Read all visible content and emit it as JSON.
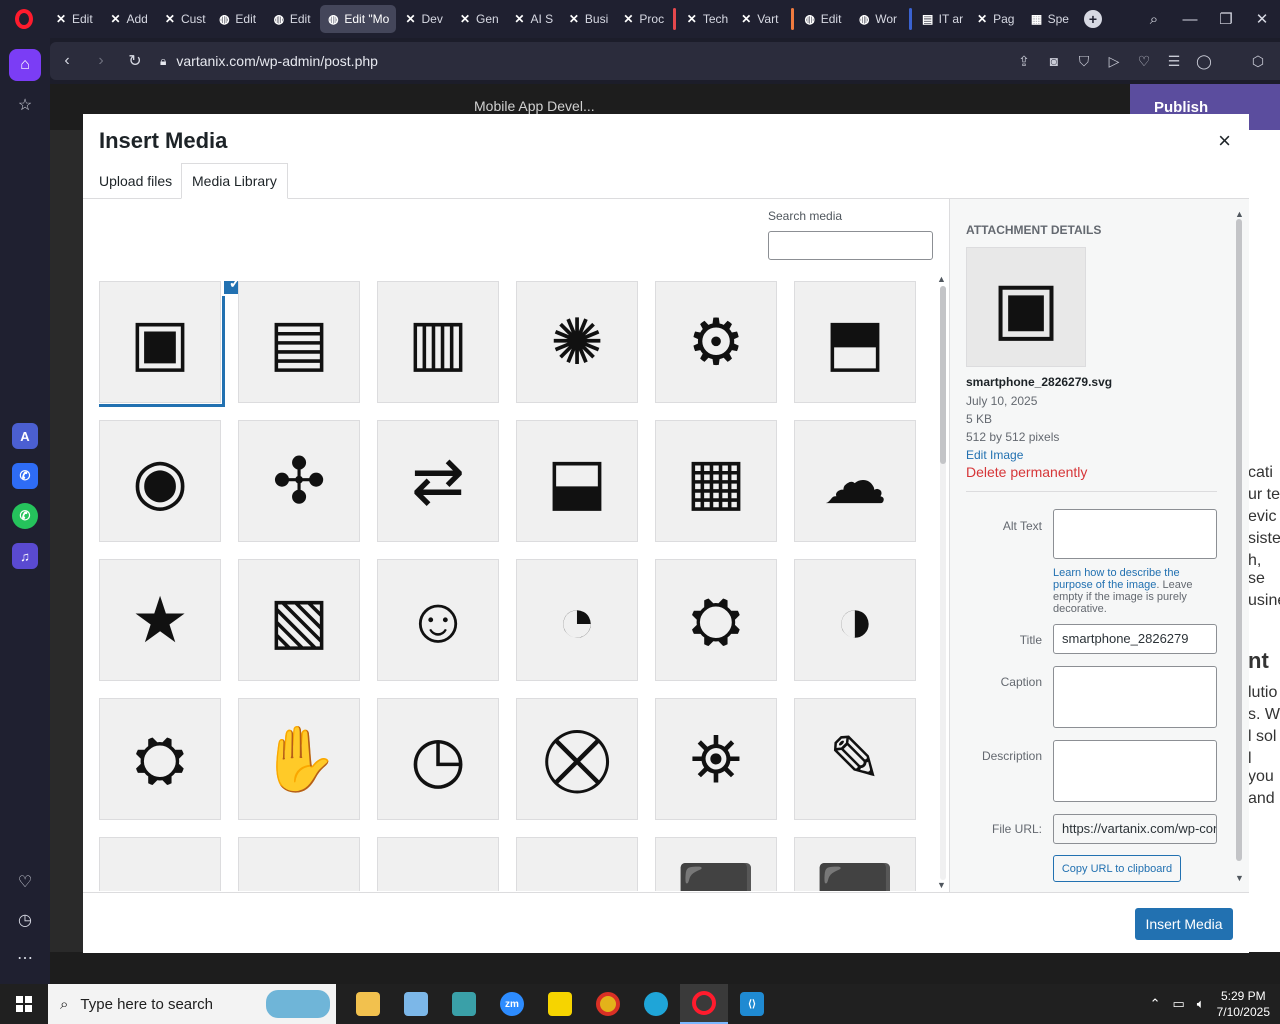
{
  "browser": {
    "tabs": [
      {
        "label": "Edit",
        "icon": "x-icon",
        "active": false
      },
      {
        "label": "Add",
        "icon": "x-icon",
        "active": false
      },
      {
        "label": "Cust",
        "icon": "x-icon",
        "active": false
      },
      {
        "label": "Edit",
        "icon": "globe-icon",
        "active": false
      },
      {
        "label": "Edit",
        "icon": "globe-icon",
        "active": false
      },
      {
        "label": "Edit \"Mo",
        "icon": "globe-icon",
        "active": true
      },
      {
        "label": "Dev",
        "icon": "x-icon",
        "active": false
      },
      {
        "label": "Gen",
        "icon": "x-icon",
        "active": false
      },
      {
        "label": "AI S",
        "icon": "x-icon",
        "active": false
      },
      {
        "label": "Busi",
        "icon": "x-icon",
        "active": false
      },
      {
        "label": "Proc",
        "icon": "x-icon",
        "active": false
      },
      {
        "label": "Tech",
        "icon": "x-icon",
        "active": false
      },
      {
        "label": "Vart",
        "icon": "x-icon",
        "active": false
      },
      {
        "label": "Edit",
        "icon": "globe-icon",
        "active": false
      },
      {
        "label": "Wor",
        "icon": "globe-icon",
        "active": false
      },
      {
        "label": "IT ar",
        "icon": "page-icon",
        "active": false
      },
      {
        "label": "Pag",
        "icon": "x-icon",
        "active": false
      },
      {
        "label": "Spe",
        "icon": "grid-icon",
        "active": false
      }
    ],
    "url": "vartanix.com/wp-admin/post.php"
  },
  "editor": {
    "doc_title": "Mobile App Devel...",
    "publish_label": "Publish",
    "right_peek": [
      "cati",
      "ur te",
      "evic",
      "siste",
      "h, se",
      "usine",
      "nt",
      "lutio",
      "s. W",
      "l sol",
      "l you",
      "and"
    ]
  },
  "modal": {
    "title": "Insert Media",
    "close_symbol": "×",
    "tabs": {
      "upload": "Upload files",
      "library": "Media Library"
    },
    "search_label": "Search media",
    "search_value": "",
    "insert_label": "Insert Media",
    "media_icons": [
      "smartphone-network-icon",
      "smartphone-dial-icon",
      "tablet-star-icon",
      "lightbulb-helpdesk-icon",
      "gear-path-user-icon",
      "browser-gear-arrow-icon",
      "idea-security-flow-icon",
      "target-arrows-icon",
      "process-flow-icon",
      "browser-bug-icon",
      "server-user-network-icon",
      "cloud-server-chart-icon",
      "phone-rating-thumb-icon",
      "phone-cloud-network-icon",
      "team-idea-icon",
      "report-cycle-clock-icon",
      "growth-conveyor-icon",
      "monitor-gauge-icon",
      "growth-conveyor-2-icon",
      "puzzle-hand-icon",
      "browser-clock-icon",
      "cart-gear-icon",
      "gear-dashboard-icon",
      "blueprint-pencil-icon",
      "browser-window-icon",
      "browser-stack-icon",
      "browser-disk-icon",
      "browser-timeline-icon",
      "box-icon",
      "box-2-icon"
    ]
  },
  "details": {
    "heading": "Attachment Details",
    "filename": "smartphone_2826279.svg",
    "date": "July 10, 2025",
    "size": "5 KB",
    "dimensions": "512 by 512 pixels",
    "edit_link": "Edit Image",
    "delete_link": "Delete permanently",
    "alt_label": "Alt Text",
    "alt_value": "",
    "help_link": "Learn how to describe the purpose of the image",
    "help_rest": ". Leave empty if the image is purely decorative.",
    "title_label": "Title",
    "title_value": "smartphone_2826279",
    "caption_label": "Caption",
    "caption_value": "",
    "description_label": "Description",
    "description_value": "",
    "fileurl_label": "File URL:",
    "fileurl_value": "https://vartanix.com/wp-content/",
    "copy_label": "Copy URL to clipboard"
  },
  "taskbar": {
    "search_placeholder": "Type here to search",
    "time": "5:29 PM",
    "date": "7/10/2025"
  },
  "colors": {
    "accent": "#2271b1",
    "danger": "#d63638",
    "opera": "#ff1b2d"
  }
}
